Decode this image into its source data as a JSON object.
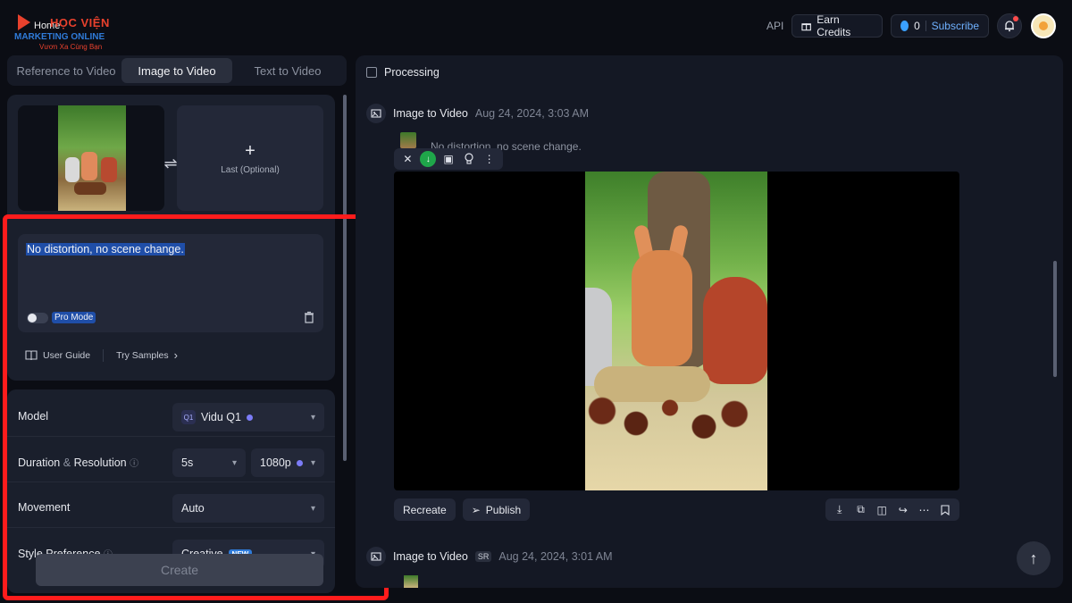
{
  "logo": {
    "home": "Home",
    "brand_top": "HỌC VIỆN",
    "brand_mid": "MARKETING ONLINE",
    "brand_bottom": "Vươn Xa Cùng Bạn"
  },
  "header": {
    "api": "API",
    "earn_credits": "Earn Credits",
    "credits": "0",
    "subscribe": "Subscribe"
  },
  "tabs": [
    {
      "label": "Reference to Video",
      "active": false
    },
    {
      "label": "Image to Video",
      "active": true
    },
    {
      "label": "Text to Video",
      "active": false
    }
  ],
  "upload": {
    "last_label": "Last (Optional)"
  },
  "prompt": {
    "text": "No distortion, no scene change.",
    "pro_mode": "Pro Mode",
    "pro_mode_on": false
  },
  "links": {
    "user_guide": "User Guide",
    "try_samples": "Try Samples"
  },
  "settings": {
    "model_label": "Model",
    "model_value": "Vidu Q1",
    "model_icon_text": "Q1",
    "duration_label": "Duration",
    "amp": "&",
    "resolution_label": "Resolution",
    "duration_value": "5s",
    "resolution_value": "1080p",
    "movement_label": "Movement",
    "movement_value": "Auto",
    "style_label": "Style Preference",
    "style_value": "Creative",
    "style_badge": "NEW"
  },
  "create": "Create",
  "right": {
    "processing": "Processing",
    "task1": {
      "title": "Image to Video",
      "date": "Aug 24, 2024, 3:03 AM",
      "prompt": "No distortion, no scene change."
    },
    "task2": {
      "title": "Image to Video",
      "badge": "SR",
      "date": "Aug 24, 2024, 3:01 AM"
    },
    "recreate": "Recreate",
    "publish": "Publish"
  },
  "colors": {
    "accent": "#2f7bd9",
    "highlight_border": "#ff1c1c",
    "background": "#0b0d14"
  }
}
